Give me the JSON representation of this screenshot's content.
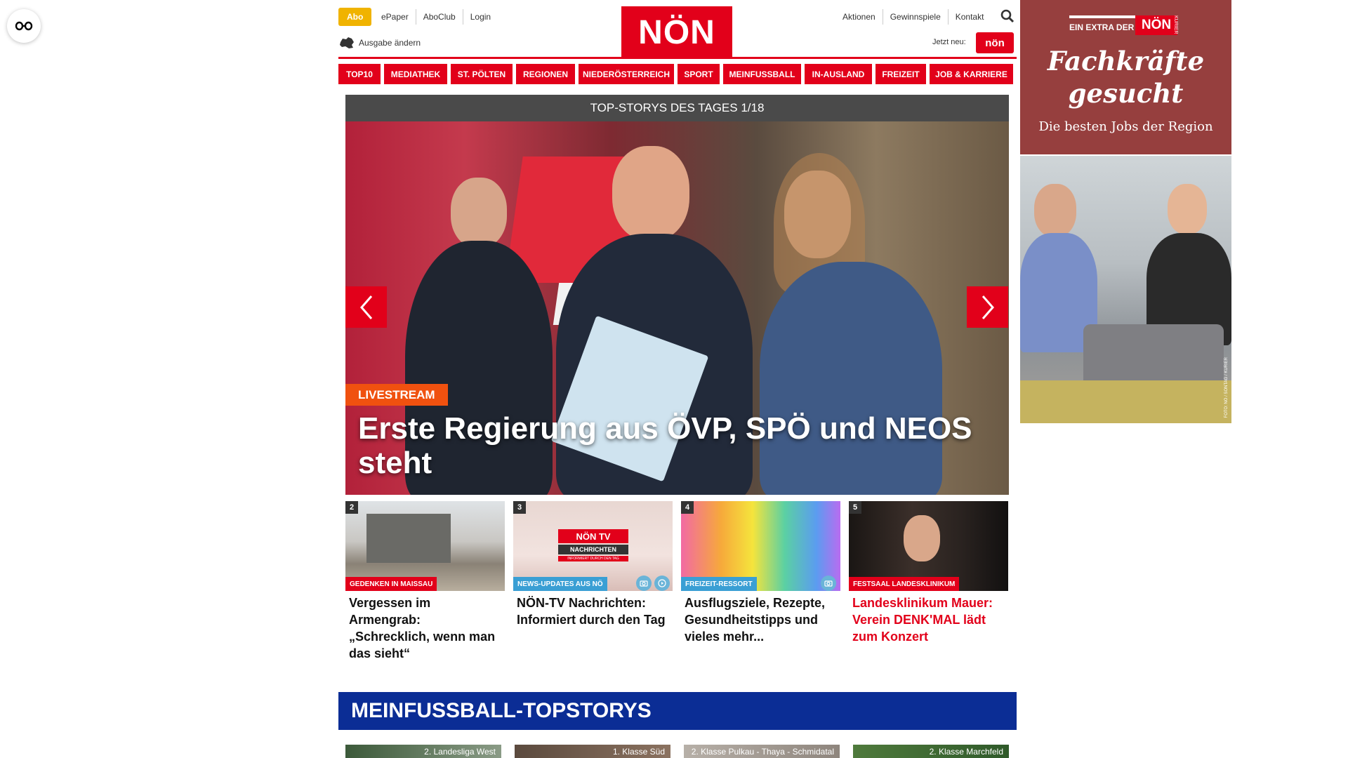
{
  "header": {
    "abo_label": "Abo",
    "top_links": [
      "ePaper",
      "AboClub",
      "Login"
    ],
    "ausgabe_label": "Ausgabe ändern",
    "logo_text": "NÖN",
    "right_links": [
      "Aktionen",
      "Gewinnspiele",
      "Kontakt"
    ],
    "jetzt_neu_label": "Jetzt neu:",
    "kleine_non_label": "nön"
  },
  "nav": {
    "items": [
      "TOP10",
      "MEDIATHEK",
      "ST. PÖLTEN",
      "REGIONEN",
      "NIEDERÖSTERREICH",
      "SPORT",
      "MEINFUSSBALL",
      "IN-AUSLAND",
      "FREIZEIT",
      "JOB & KARRIERE"
    ]
  },
  "top_stories": {
    "header": "TOP-STORYS DES TAGES 1/18",
    "hero": {
      "badge": "LIVESTREAM",
      "title": "Erste Regierung aus ÖVP, SPÖ und NEOS steht"
    },
    "cards": [
      {
        "num": "2",
        "tag": "GEDENKEN IN MAISSAU",
        "tag_color": "#e2001a",
        "title": "Vergessen im Armengrab: „Schrecklich, wenn man das sieht“"
      },
      {
        "num": "3",
        "tag": "NEWS-UPDATES AUS NÖ",
        "tag_color": "#3a9fd4",
        "title": "NÖN-TV Nachrichten: Informiert durch den Tag"
      },
      {
        "num": "4",
        "tag": "FREIZEIT-RESSORT",
        "tag_color": "#3a9fd4",
        "title": "Ausflugsziele, Rezepte, Gesundheitstipps und vieles mehr..."
      },
      {
        "num": "5",
        "tag": "FESTSAAL LANDESKLINIKUM",
        "tag_color": "#e2001a",
        "title": "Landesklinikum Mauer: Verein DENK'MAL lädt zum Konzert"
      }
    ],
    "tv_thumb": {
      "brand": "NÖN TV",
      "label": "NACHRICHTEN",
      "sub": "INFORMIERT DURCH DEN TAG"
    }
  },
  "meinfussball": {
    "header": "MEINFUSSBALL-TOPSTORYS",
    "thumbs": [
      "2. Landesliga West",
      "1. Klasse Süd",
      "2. Klasse Pulkau - Thaya - Schmidatal",
      "2. Klasse Marchfeld"
    ]
  },
  "ad": {
    "extra_label": "EIN EXTRA DER",
    "extra_brand": "NÖN",
    "extra_side": "KURIER",
    "headline": "Fachkräfte gesucht",
    "sub": "Die besten Jobs der Region",
    "photo_credit": "FOTO: NÖ / SONTAG / KURIER"
  }
}
